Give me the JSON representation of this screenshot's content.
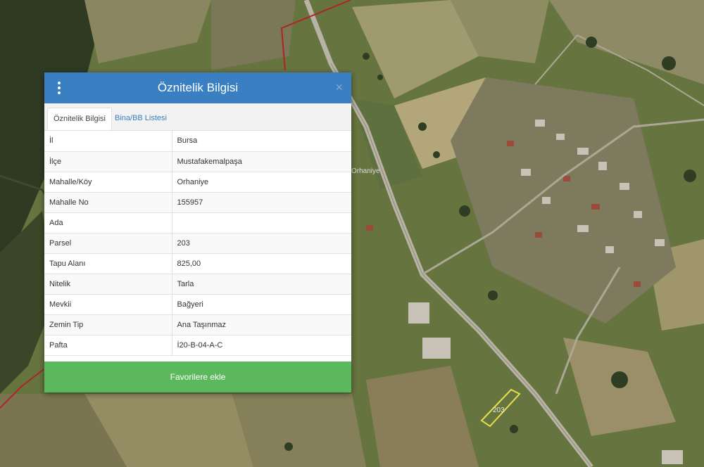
{
  "map": {
    "parcel_label": "203",
    "road_label": "Orhaniye"
  },
  "panel": {
    "title": "Öznitelik Bilgisi",
    "tabs": [
      {
        "label": "Öznitelik Bilgisi",
        "active": true
      },
      {
        "label": "Bina/BB Listesi",
        "active": false
      }
    ],
    "rows": [
      {
        "key": "İl",
        "value": "Bursa"
      },
      {
        "key": "İlçe",
        "value": "Mustafakemalpaşa"
      },
      {
        "key": "Mahalle/Köy",
        "value": "Orhaniye"
      },
      {
        "key": "Mahalle No",
        "value": "155957"
      },
      {
        "key": "Ada",
        "value": ""
      },
      {
        "key": "Parsel",
        "value": "203"
      },
      {
        "key": "Tapu Alanı",
        "value": "825,00"
      },
      {
        "key": "Nitelik",
        "value": "Tarla"
      },
      {
        "key": "Mevkii",
        "value": "Bağyeri"
      },
      {
        "key": "Zemin Tip",
        "value": "Ana Taşınmaz"
      },
      {
        "key": "Pafta",
        "value": "İ20-B-04-A-C"
      }
    ],
    "button_label": "Favorilere ekle",
    "close_symbol": "×"
  }
}
